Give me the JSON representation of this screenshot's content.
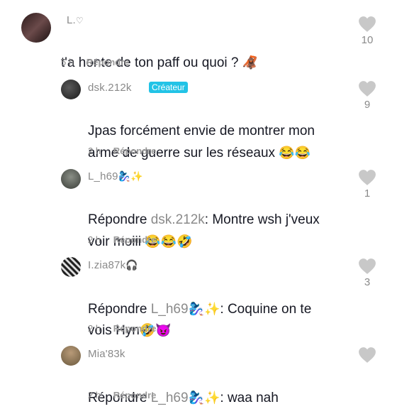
{
  "comments": [
    {
      "username": "L.",
      "username_suffix": "♡",
      "text": "t'a honte de ton paff ou quoi ? ",
      "emoji": "🦧",
      "time": "5 h",
      "reply_label": "Répondre",
      "likes": "10"
    },
    {
      "username": "dsk.212k",
      "badge": "Créateur",
      "text_line1": "Jpas forcément envie de montrer mon",
      "text_line2": "arme de guerre sur les réseaux ",
      "emoji": "😂😂",
      "time": "2 h",
      "reply_label": "Répondre",
      "likes": "9"
    },
    {
      "username": "L_h69",
      "username_emoji": "🧞‍♀️✨",
      "reply_prefix": "Répondre ",
      "mention": "dsk.212k",
      "text_after": ": Montre wsh j'veux",
      "text_line2": "voir moiii ",
      "emoji": "😂😂🤣",
      "time": "2 h",
      "reply_label": "Répondre",
      "likes": "1"
    },
    {
      "username": "I.zia87k",
      "username_emoji": "🎧",
      "reply_prefix": "Répondre ",
      "mention": "L_h69",
      "mention_emoji": "🧞‍♀️✨",
      "text_after": ": Coquine on te",
      "text_line2": "vois Hyn",
      "emoji": "🤣😈",
      "time": "2 h",
      "reply_label": "Répondre",
      "likes": "3"
    },
    {
      "username": "Mia'83k",
      "reply_prefix": "Répondre ",
      "mention": "L_h69",
      "mention_emoji": "🧞‍♀️✨",
      "text_after": ": waa nah",
      "time": "2 h",
      "reply_label": "Répondre",
      "likes": ""
    }
  ],
  "colors": {
    "badge": "#22c3e6",
    "muted": "#8a8a8a",
    "text": "#161823",
    "heart": "#c8c8c8"
  },
  "icons": [
    "heart-icon"
  ]
}
